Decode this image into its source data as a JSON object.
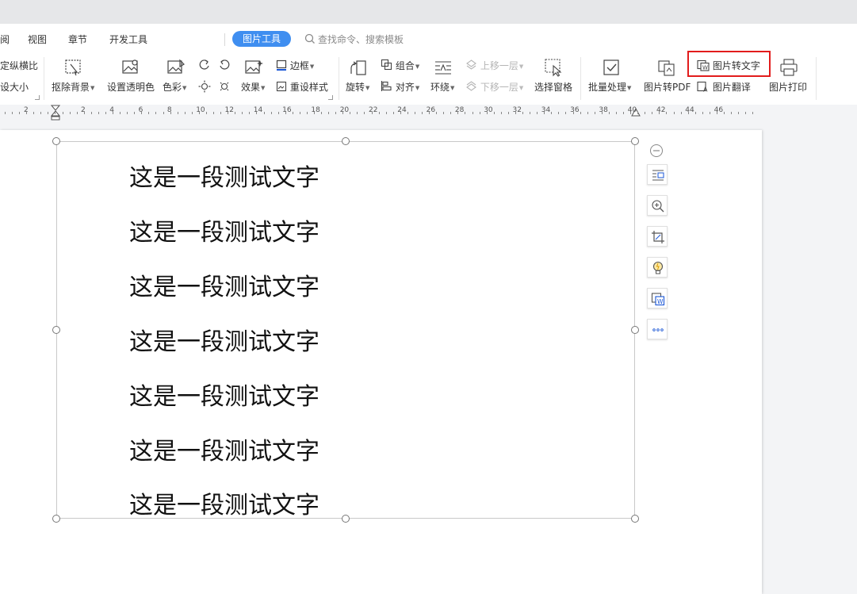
{
  "menu": {
    "items": [
      "阅",
      "视图",
      "章节",
      "开发工具"
    ],
    "active_tab": "图片工具",
    "search_placeholder": "查找命令、搜索模板"
  },
  "ribbon": {
    "lock_ratio": "定纵横比",
    "reset_size": "设大小",
    "remove_bg": "抠除背景",
    "set_transparent": "设置透明色",
    "color": "色彩",
    "effect": "效果",
    "border": "边框",
    "reset_style": "重设样式",
    "rotate": "旋转",
    "group": "组合",
    "align": "对齐",
    "wrap": "环绕",
    "move_up": "上移一层",
    "move_down": "下移一层",
    "selection_pane": "选择窗格",
    "batch": "批量处理",
    "to_pdf": "图片转PDF",
    "to_text": "图片转文字",
    "translate": "图片翻译",
    "print": "图片打印"
  },
  "ruler": {
    "labels": [
      "2",
      "2",
      "4",
      "6",
      "8",
      "10",
      "12",
      "14",
      "16",
      "18",
      "20",
      "22",
      "24",
      "26",
      "28",
      "30",
      "32",
      "34",
      "36",
      "38",
      "40",
      "42",
      "44",
      "46"
    ]
  },
  "document": {
    "lines": [
      "这是一段测试文字",
      "这是一段测试文字",
      "这是一段测试文字",
      "这是一段测试文字",
      "这是一段测试文字",
      "这是一段测试文字",
      "这是一段测试文字"
    ]
  },
  "colors": {
    "accent": "#3f8ef0",
    "highlight": "#e21c1c"
  }
}
